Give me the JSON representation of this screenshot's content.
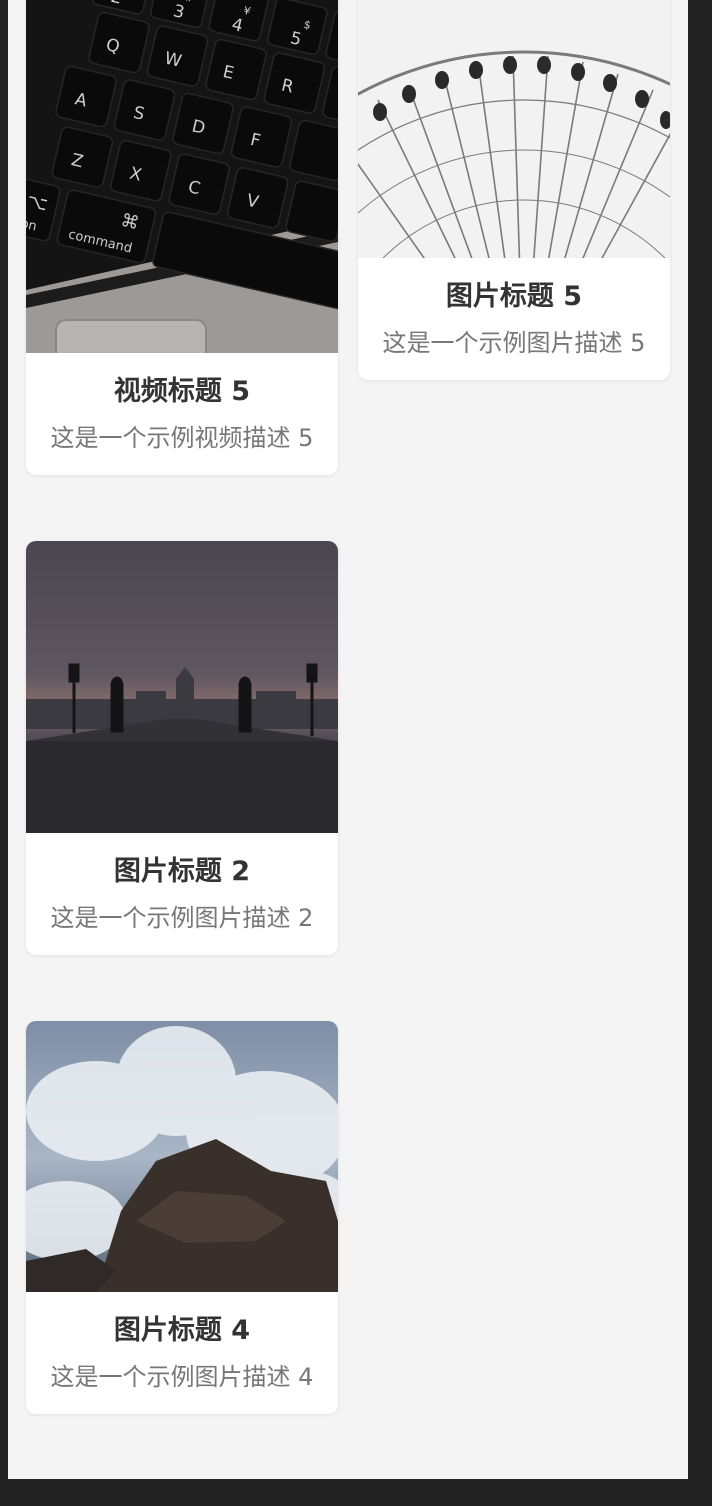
{
  "cards": [
    {
      "title": "视频标题 5",
      "description": "这是一个示例视频描述 5",
      "media": "keyboard-video-thumbnail"
    },
    {
      "title": "图片标题 5",
      "description": "这是一个示例图片描述 5",
      "media": "ferris-wheel-image"
    },
    {
      "title": "图片标题 2",
      "description": "这是一个示例图片描述 2",
      "media": "bridge-dusk-image"
    },
    {
      "title": "图片标题 4",
      "description": "这是一个示例图片描述 4",
      "media": "waves-rocks-image"
    }
  ],
  "keyboard_keys": [
    "2",
    "3",
    "4",
    "5",
    "Q",
    "W",
    "E",
    "R",
    "A",
    "S",
    "D",
    "F",
    "Z",
    "X",
    "C",
    "V",
    "⌘",
    "command",
    "option",
    "⌥",
    "#",
    "$",
    "%",
    "¥"
  ],
  "colors": {
    "background": "#222222",
    "page": "#f4f4f4",
    "card": "#ffffff",
    "title": "#333333",
    "description": "#777777"
  }
}
